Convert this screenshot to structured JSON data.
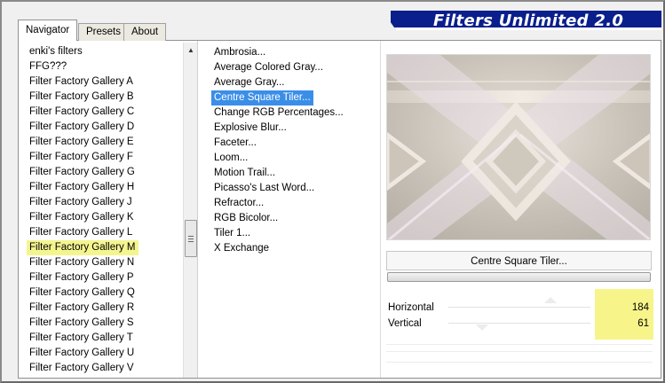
{
  "app": {
    "title": "Filters Unlimited 2.0"
  },
  "tabs": [
    {
      "label": "Navigator",
      "active": true
    },
    {
      "label": "Presets",
      "active": false
    },
    {
      "label": "About",
      "active": false
    }
  ],
  "categories": {
    "items": [
      "enki's filters",
      "FFG???",
      "Filter Factory Gallery A",
      "Filter Factory Gallery B",
      "Filter Factory Gallery C",
      "Filter Factory Gallery D",
      "Filter Factory Gallery E",
      "Filter Factory Gallery F",
      "Filter Factory Gallery G",
      "Filter Factory Gallery H",
      "Filter Factory Gallery J",
      "Filter Factory Gallery K",
      "Filter Factory Gallery L",
      "Filter Factory Gallery M",
      "Filter Factory Gallery N",
      "Filter Factory Gallery P",
      "Filter Factory Gallery Q",
      "Filter Factory Gallery R",
      "Filter Factory Gallery S",
      "Filter Factory Gallery T",
      "Filter Factory Gallery U",
      "Filter Factory Gallery V"
    ],
    "selected": "Filter Factory Gallery M",
    "highlight_color": "#f5f590"
  },
  "filters": {
    "items": [
      "Ambrosia...",
      "Average Colored Gray...",
      "Average Gray...",
      "Centre Square Tiler...",
      "Change RGB Percentages...",
      "Explosive Blur...",
      "Faceter...",
      "Loom...",
      "Motion Trail...",
      "Picasso's Last Word...",
      "Refractor...",
      "RGB Bicolor...",
      "Tiler 1...",
      "X Exchange"
    ],
    "selected": "Centre Square Tiler...",
    "selection_color": "#3b8ee8"
  },
  "preview": {
    "filter_name": "Centre Square Tiler..."
  },
  "params": [
    {
      "label": "Horizontal",
      "value": "184",
      "fraction": 0.72
    },
    {
      "label": "Vertical",
      "value": "61",
      "fraction": 0.24
    }
  ],
  "colors": {
    "banner": "#0a1f8c",
    "value_highlight": "#f7f58a"
  },
  "icons": {
    "scroll_up": "scroll-up-arrow-icon",
    "scroll_thumb": "scroll-thumb-grip-icon"
  }
}
